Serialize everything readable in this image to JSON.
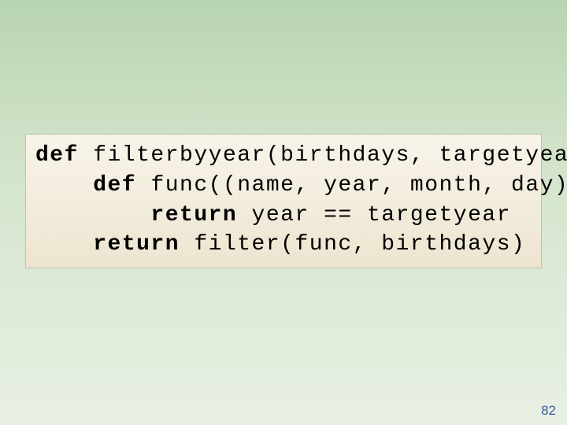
{
  "code": {
    "lines": [
      {
        "kw": "def",
        "rest": " filterbyyear(birthdays, targetyear):"
      },
      {
        "indent": "    ",
        "kw": "def",
        "rest": " func((name, year, month, day)):"
      },
      {
        "indent": "        ",
        "kw": "return",
        "rest": " year == targetyear"
      },
      {
        "indent": "    ",
        "kw": "return",
        "rest": " filter(func, birthdays)"
      }
    ]
  },
  "page_number": "82"
}
